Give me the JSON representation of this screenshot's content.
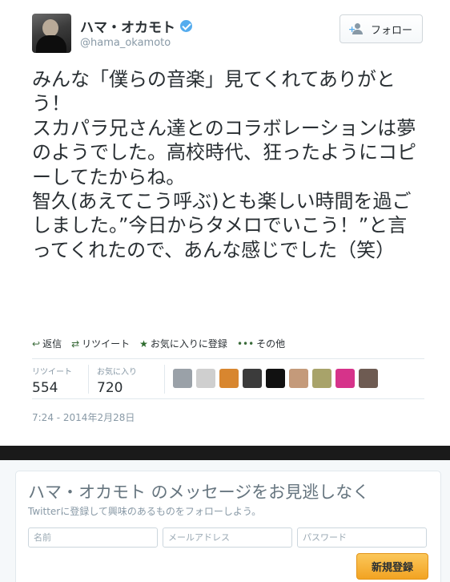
{
  "user": {
    "display_name": "ハマ・オカモト",
    "handle": "@hama_okamoto"
  },
  "follow_button": {
    "label": "フォロー",
    "icon": "add-user-icon"
  },
  "tweet": {
    "text": "みんな「僕らの音楽」見てくれてありがとう！\nスカパラ兄さん達とのコラボレーションは夢のようでした。高校時代、狂ったようにコピーしてたからね。\n智久(あえてこう呼ぶ)とも楽しい時間を過ごしました。”今日からタメロでいこう！”と言ってくれたので、あんな感じでした（笑）",
    "timestamp": "7:24 - 2014年2月28日"
  },
  "actions": [
    {
      "name": "reply",
      "label": "返信",
      "icon": "reply-icon"
    },
    {
      "name": "retweet",
      "label": "リツイート",
      "icon": "retweet-icon"
    },
    {
      "name": "favorite",
      "label": "お気に入りに登録",
      "icon": "star-icon"
    },
    {
      "name": "more",
      "label": "その他",
      "icon": "ellipsis-icon"
    }
  ],
  "stats": {
    "retweets_label": "リツイート",
    "retweets_value": "554",
    "favorites_label": "お気に入り",
    "favorites_value": "720"
  },
  "favoriters": [
    {
      "color": "#9aa1a8"
    },
    {
      "color": "#cfcfcf"
    },
    {
      "color": "#d8862f"
    },
    {
      "color": "#3b3b3b"
    },
    {
      "color": "#111111"
    },
    {
      "color": "#c49a7a"
    },
    {
      "color": "#a8a36a"
    },
    {
      "color": "#d6338a"
    },
    {
      "color": "#6e5b52"
    }
  ],
  "signup": {
    "title": "ハマ・オカモト のメッセージをお見逃しなく",
    "subtitle": "Twitterに登録して興味のあるものをフォローしよう。",
    "name_placeholder": "名前",
    "email_placeholder": "メールアドレス",
    "password_placeholder": "パスワード",
    "button_label": "新規登録"
  },
  "colors": {
    "link_blue": "#55acee",
    "signup_button": "#f2a322",
    "divider_band": "#1a1a1a"
  }
}
